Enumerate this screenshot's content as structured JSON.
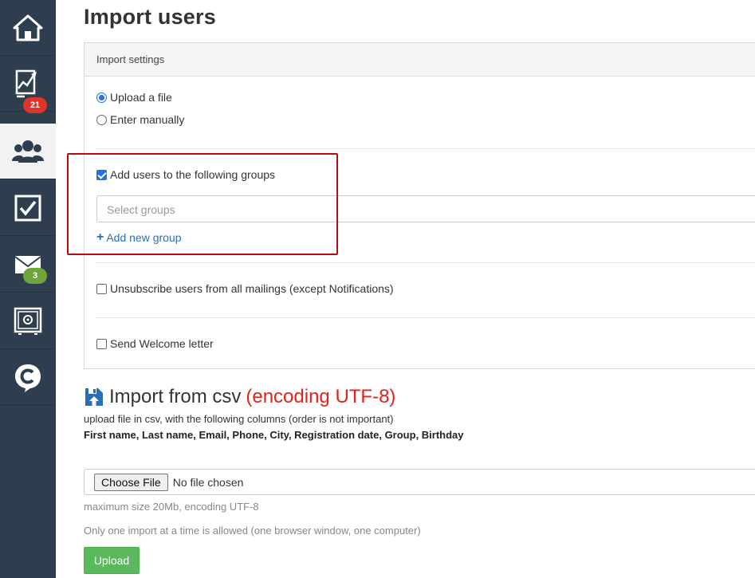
{
  "sidebar": {
    "items": [
      {
        "icon": "home-icon",
        "badge": ""
      },
      {
        "icon": "chart-icon",
        "badge": "21"
      },
      {
        "icon": "users-icon",
        "badge": ""
      },
      {
        "icon": "checkbox-icon",
        "badge": ""
      },
      {
        "icon": "mail-icon",
        "badge": "3"
      },
      {
        "icon": "safe-icon",
        "badge": ""
      },
      {
        "icon": "chat-c-icon",
        "badge": ""
      }
    ],
    "active_index": 2,
    "colors": {
      "bg": "#2e3e4e",
      "active_bg": "#f2f2f2",
      "badge_red": "#e2332a",
      "badge_green": "#6fa53a"
    }
  },
  "page": {
    "title": "Import users"
  },
  "settings": {
    "header": "Import settings",
    "mode_options": [
      {
        "label": "Upload a file",
        "selected": true
      },
      {
        "label": "Enter manually",
        "selected": false
      }
    ],
    "add_to_groups": {
      "label": "Add users to the following groups",
      "checked": true
    },
    "groups_select": {
      "placeholder": "Select groups"
    },
    "add_new_group": "Add new group",
    "unsubscribe": {
      "label": "Unsubscribe users from all mailings (except Notifications)",
      "checked": false
    },
    "welcome": {
      "label": "Send Welcome letter",
      "checked": false
    }
  },
  "csv": {
    "title": "Import from csv",
    "encoding_label": "(encoding UTF-8)",
    "description": "upload file in csv, with the following columns (order is not important)",
    "columns": "First name, Last name, Email, Phone, City, Registration date, Group, Birthday",
    "choose_file": "Choose File",
    "no_file": "No file chosen",
    "max_size_note": "maximum size 20Mb, encoding UTF-8",
    "one_import_note": "Only one import at a time is allowed (one browser window, one computer)",
    "upload_button": "Upload"
  },
  "colors": {
    "accent_link": "#2a6fb5",
    "encoding_red": "#e3221c",
    "upload_green": "#5cb85c",
    "highlight_border": "#b01010"
  }
}
